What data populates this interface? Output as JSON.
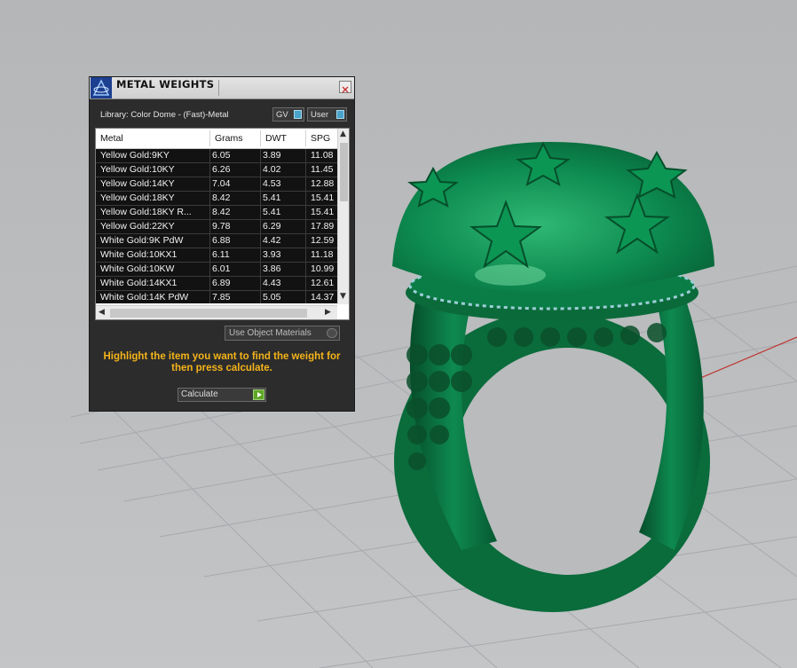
{
  "dialog": {
    "title": "METAL WEIGHTS",
    "library_label": "Library: Color Dome - (Fast)-Metal",
    "toggles": [
      {
        "label": "GV"
      },
      {
        "label": "User"
      }
    ],
    "table": {
      "headers": [
        "Metal",
        "Grams",
        "DWT",
        "SPG"
      ],
      "rows": [
        [
          "Yellow Gold:9KY",
          "6.05",
          "3.89",
          "11.08"
        ],
        [
          "Yellow Gold:10KY",
          "6.26",
          "4.02",
          "11.45"
        ],
        [
          "Yellow Gold:14KY",
          "7.04",
          "4.53",
          "12.88"
        ],
        [
          "Yellow Gold:18KY",
          "8.42",
          "5.41",
          "15.41"
        ],
        [
          "Yellow Gold:18KY R...",
          "8.42",
          "5.41",
          "15.41"
        ],
        [
          "Yellow Gold:22KY",
          "9.78",
          "6.29",
          "17.89"
        ],
        [
          "White Gold:9K PdW",
          "6.88",
          "4.42",
          "12.59"
        ],
        [
          "White Gold:10KX1",
          "6.11",
          "3.93",
          "11.18"
        ],
        [
          "White Gold:10KW",
          "6.01",
          "3.86",
          "10.99"
        ],
        [
          "White Gold:14KX1",
          "6.89",
          "4.43",
          "12.61"
        ],
        [
          "White Gold:14K PdW",
          "7.85",
          "5.05",
          "14.37"
        ]
      ]
    },
    "use_object_materials": "Use Object Materials",
    "hint": "Highlight the item you want to find the weight for then press calculate.",
    "calculate_label": "Calculate"
  },
  "colors": {
    "dialog_bg": "#2c2c2c",
    "hint": "#f4b41a",
    "ring_green": "#0f7a45",
    "grid_line": "#a8aaad",
    "axis_x": "#c0312b",
    "axis_y": "#3a9a3a"
  },
  "icons": {
    "app": "app-logo-icon",
    "close": "close-icon",
    "toggle": "toggle-switch-icon",
    "calculate": "play-arrow-icon"
  }
}
